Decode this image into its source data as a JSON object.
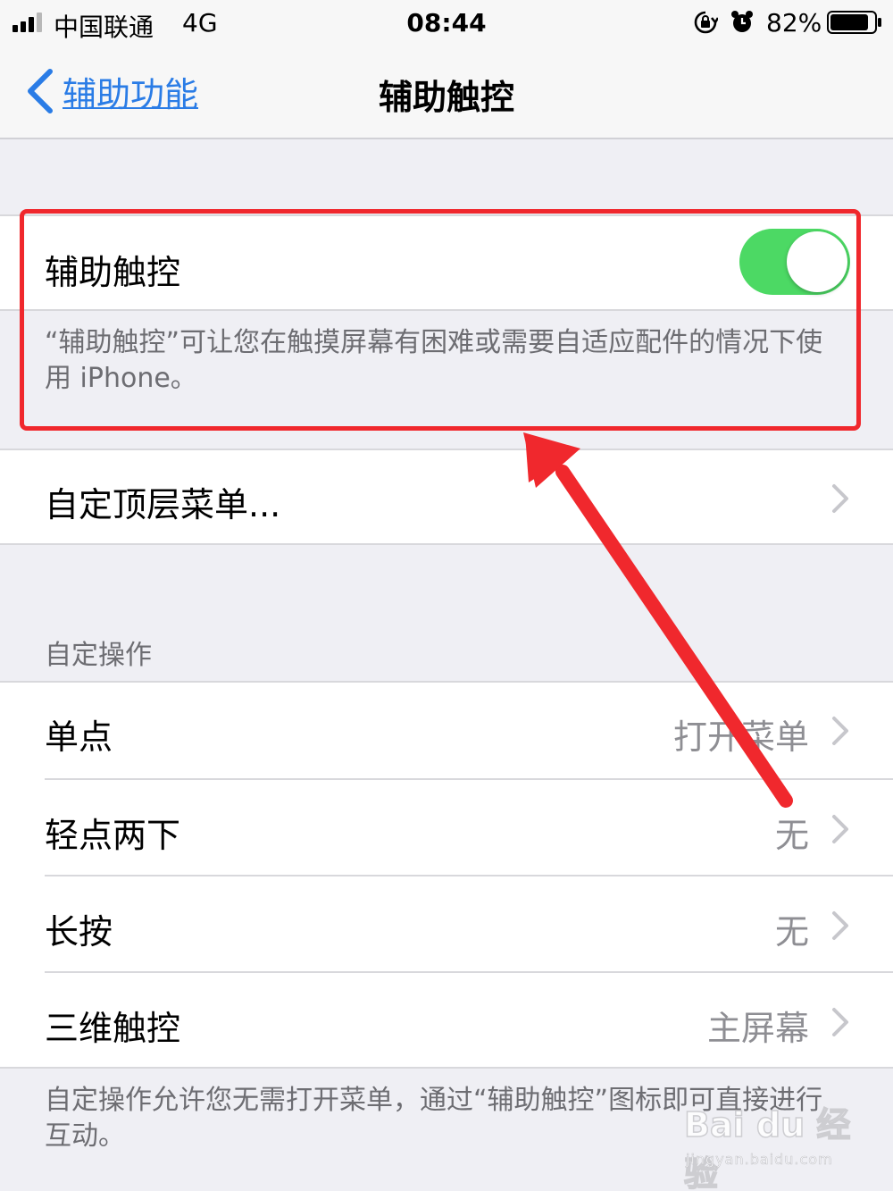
{
  "status_bar": {
    "carrier": "中国联通",
    "network": "4G",
    "time": "08:44",
    "battery": "82%"
  },
  "nav": {
    "back_label": "辅助功能",
    "title": "辅助触控"
  },
  "assistive_touch": {
    "label": "辅助触控",
    "enabled": true,
    "toggle_color": "#4cd964",
    "description": "“辅助触控”可让您在触摸屏幕有困难或需要自适应配件的情况下使用 iPhone。"
  },
  "top_menu": {
    "label": "自定顶层菜单..."
  },
  "custom_actions": {
    "header": "自定操作",
    "items": [
      {
        "label": "单点",
        "value": "打开菜单"
      },
      {
        "label": "轻点两下",
        "value": "无"
      },
      {
        "label": "长按",
        "value": "无"
      },
      {
        "label": "三维触控",
        "value": "主屏幕"
      }
    ],
    "footer": "自定操作允许您无需打开菜单，通过“辅助触控”图标即可直接进行互动。"
  },
  "annotation": {
    "color": "#f0282d"
  },
  "watermark": {
    "logo": "Bai du 经验",
    "url": "jingyan.baidu.com"
  },
  "colors": {
    "accent": "#2a7ce6",
    "background": "#efeff4"
  }
}
